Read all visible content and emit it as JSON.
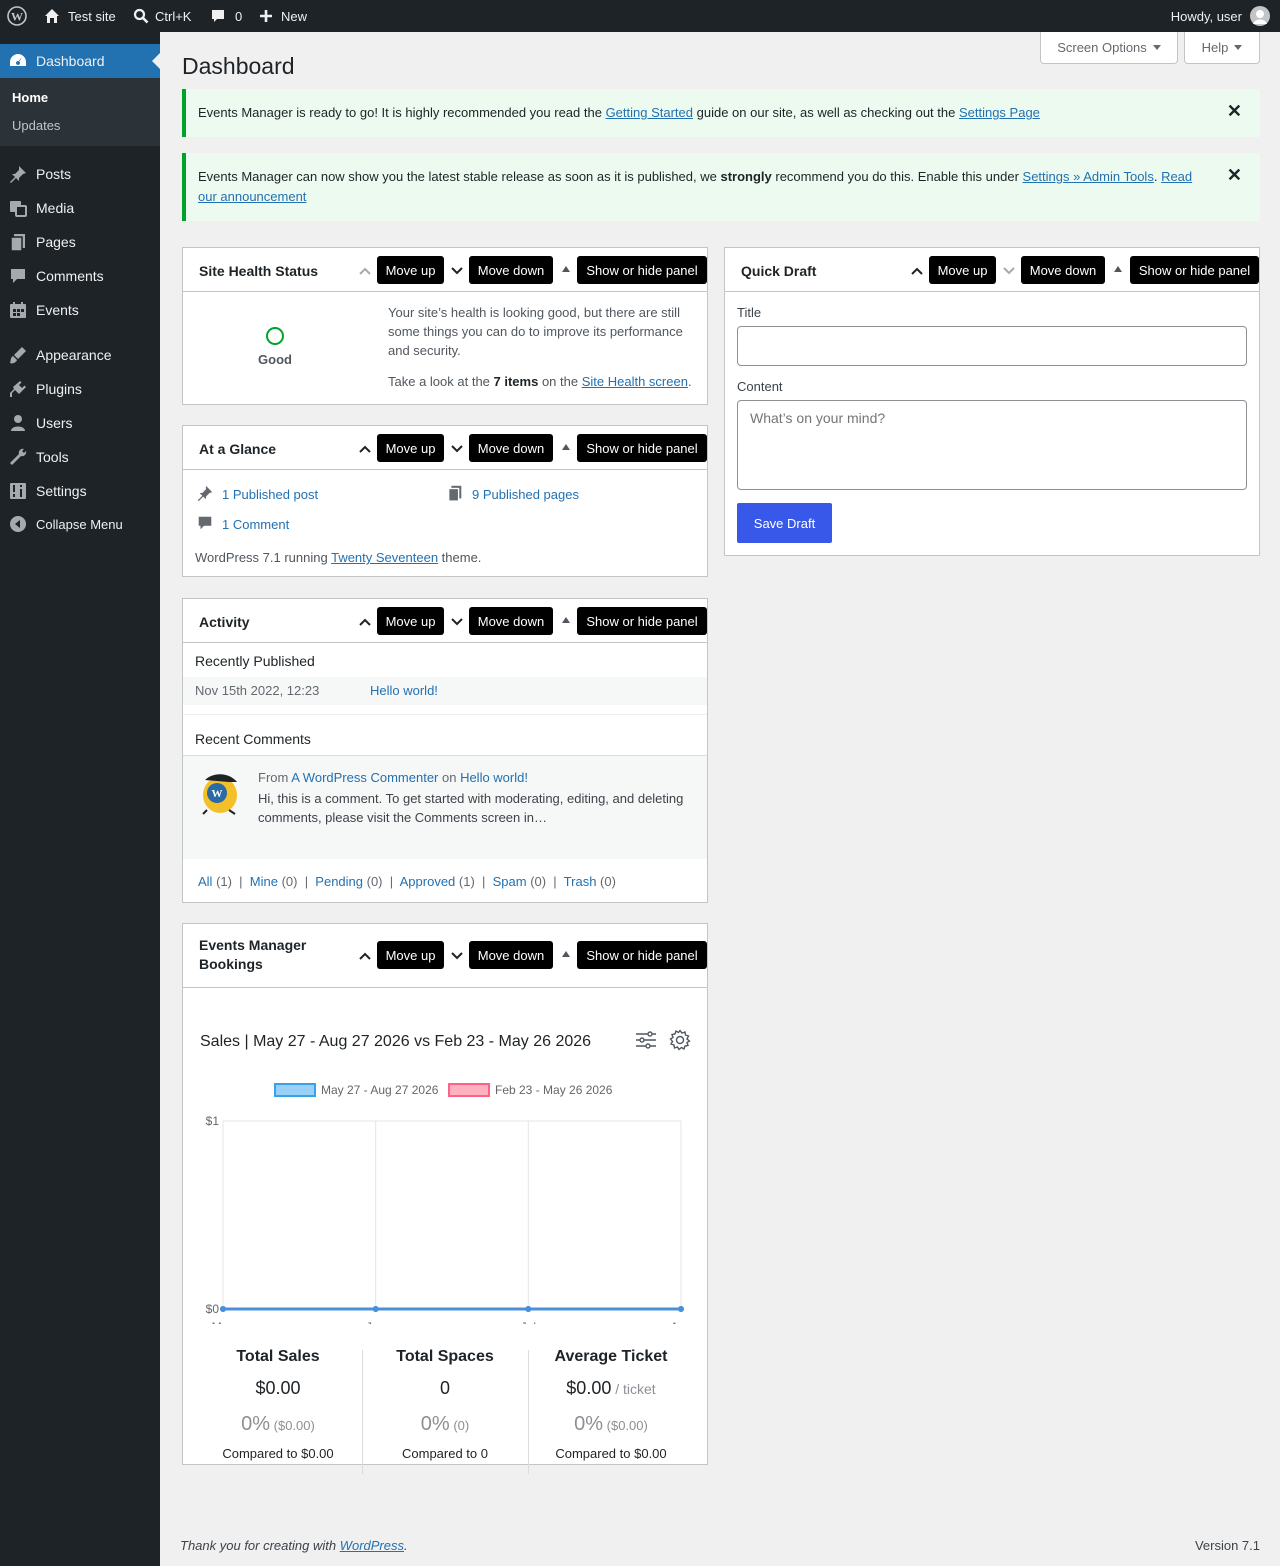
{
  "adminbar": {
    "site_name": "Test site",
    "search_shortcut": "Ctrl+K",
    "comments_count": "0",
    "new_label": "New",
    "howdy": "Howdy, user"
  },
  "sidebar": {
    "dashboard": "Dashboard",
    "submenu": [
      "Home",
      "Updates"
    ],
    "items": [
      {
        "label": "Posts",
        "icon": "pin-icon"
      },
      {
        "label": "Media",
        "icon": "media-icon"
      },
      {
        "label": "Pages",
        "icon": "pages-icon"
      },
      {
        "label": "Comments",
        "icon": "comment-icon"
      },
      {
        "label": "Events",
        "icon": "calendar-icon"
      },
      {
        "label": "Appearance",
        "icon": "brush-icon"
      },
      {
        "label": "Plugins",
        "icon": "plugin-icon"
      },
      {
        "label": "Users",
        "icon": "user-icon"
      },
      {
        "label": "Tools",
        "icon": "wrench-icon"
      },
      {
        "label": "Settings",
        "icon": "settings-icon"
      }
    ],
    "collapse": "Collapse Menu"
  },
  "header": {
    "screen_options": "Screen Options",
    "help": "Help",
    "title": "Dashboard"
  },
  "notices": {
    "n1": {
      "t1": "Events Manager is ready to go! It is highly recommended you read the ",
      "link1": "Getting Started",
      "t2": " guide on our site, as well as checking out the ",
      "link2": "Settings Page"
    },
    "n2": {
      "t1": "Events Manager can now show you the latest stable release as soon as it is published, we ",
      "strong": "strongly",
      "t2": " recommend you do this. Enable this under ",
      "link1": "Settings » Admin Tools",
      "t3": ". ",
      "link2": "Read our announcement"
    }
  },
  "panel_controls": {
    "move_up": "Move up",
    "move_down": "Move down",
    "toggle": "Show or hide panel"
  },
  "site_health": {
    "title": "Site Health Status",
    "status": "Good",
    "desc": "Your site’s health is looking good, but there are still some things you can do to improve its performance and security.",
    "look_pre": "Take a look at the ",
    "items": "7 items",
    "look_mid": " on the ",
    "link": "Site Health screen",
    "look_post": "."
  },
  "glance": {
    "title": "At a Glance",
    "posts": "1 Published post",
    "pages": "9 Published pages",
    "comments": "1 Comment",
    "wp_pre": "WordPress 7.1 running ",
    "theme": "Twenty Seventeen",
    "wp_post": " theme."
  },
  "activity": {
    "title": "Activity",
    "recent_published": "Recently Published",
    "pub_date": "Nov 15th 2022, 12:23",
    "pub_link": "Hello world!",
    "recent_comments": "Recent Comments",
    "from": "From ",
    "commenter": "A WordPress Commenter",
    "on": " on ",
    "post": "Hello world!",
    "excerpt": "Hi, this is a comment. To get started with moderating, editing, and deleting comments, please visit the Comments screen in…",
    "filters": [
      {
        "label": "All",
        "count": "(1)"
      },
      {
        "label": "Mine",
        "count": "(0)"
      },
      {
        "label": "Pending",
        "count": "(0)"
      },
      {
        "label": "Approved",
        "count": "(1)"
      },
      {
        "label": "Spam",
        "count": "(0)"
      },
      {
        "label": "Trash",
        "count": "(0)"
      }
    ]
  },
  "bookings": {
    "title_line1": "Events Manager",
    "title_line2": "Bookings",
    "sales_title": "Sales | May 27 - Aug 27 2026 vs Feb 23 - May 26 2026",
    "stats": [
      {
        "heading": "Total Sales",
        "value": "$0.00",
        "suffix": "",
        "pct": "0%",
        "pct_note": "($0.00)",
        "compare": "Compared to $0.00"
      },
      {
        "heading": "Total Spaces",
        "value": "0",
        "suffix": "",
        "pct": "0%",
        "pct_note": "(0)",
        "compare": "Compared to 0"
      },
      {
        "heading": "Average Ticket",
        "value": "$0.00",
        "suffix": "/ ticket",
        "pct": "0%",
        "pct_note": "($0.00)",
        "compare": "Compared to $0.00"
      }
    ]
  },
  "chart_data": {
    "type": "line",
    "categories": [
      "May",
      "Jun",
      "Jul",
      "Aug"
    ],
    "series": [
      {
        "name": "May 27 - Aug 27 2026",
        "values": [
          0,
          0,
          0,
          0
        ],
        "color": "#36a2eb"
      },
      {
        "name": "Feb 23 - May 26 2026",
        "values": [
          0,
          0,
          0,
          0
        ],
        "color": "#ff6384"
      }
    ],
    "y_ticks": [
      "$0",
      "$1"
    ],
    "ylim": [
      0,
      1
    ],
    "legend": "top"
  },
  "quick_draft": {
    "title": "Quick Draft",
    "title_label": "Title",
    "title_value": "",
    "content_label": "Content",
    "content_placeholder": "What’s on your mind?",
    "save": "Save Draft"
  },
  "footer": {
    "thanks_pre": "Thank you for creating with ",
    "wp": "WordPress",
    "thanks_post": ".",
    "version": "Version 7.1"
  },
  "colors": {
    "accent": "#2271b1",
    "sidebar": "#1d2327",
    "notice_border": "#00a32a"
  }
}
